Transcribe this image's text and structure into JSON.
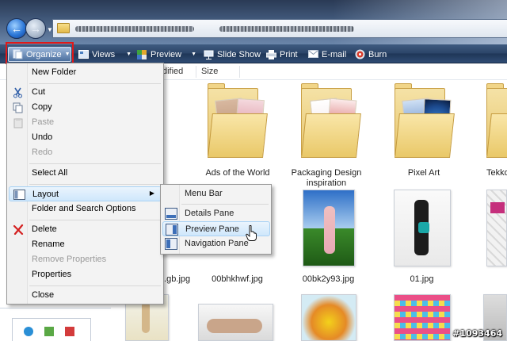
{
  "window": {
    "address_text": ""
  },
  "toolbar": {
    "organize_label": "Organize",
    "views_label": "Views",
    "preview_label": "Preview",
    "slideshow_label": "Slide Show",
    "print_label": "Print",
    "email_label": "E-mail",
    "burn_label": "Burn"
  },
  "columns": {
    "modified_partial": "dified",
    "size": "Size"
  },
  "folders": [
    {
      "label": "Ads of the World"
    },
    {
      "label": "Packaging Design inspiration"
    },
    {
      "label": "Pixel Art"
    },
    {
      "label": "Tekko"
    }
  ],
  "files": [
    {
      "label": "...gb.jpg"
    },
    {
      "label": "00bhkhwf.jpg"
    },
    {
      "label": "00bk2y93.jpg"
    },
    {
      "label": "01.jpg"
    }
  ],
  "organize_menu": {
    "new_folder": "New Folder",
    "cut": "Cut",
    "copy": "Copy",
    "paste": "Paste",
    "undo": "Undo",
    "redo": "Redo",
    "select_all": "Select All",
    "layout": "Layout",
    "folder_search_options": "Folder and Search Options",
    "delete": "Delete",
    "rename": "Rename",
    "remove_properties": "Remove Properties",
    "properties": "Properties",
    "close": "Close"
  },
  "layout_submenu": {
    "menu_bar": "Menu Bar",
    "details_pane": "Details Pane",
    "preview_pane": "Preview Pane",
    "navigation_pane": "Navigation Pane"
  },
  "watermark": "#1093464",
  "colors": {
    "toolbar": "#2b4468",
    "highlight": "#cfe7fb",
    "callout": "#e01818"
  }
}
